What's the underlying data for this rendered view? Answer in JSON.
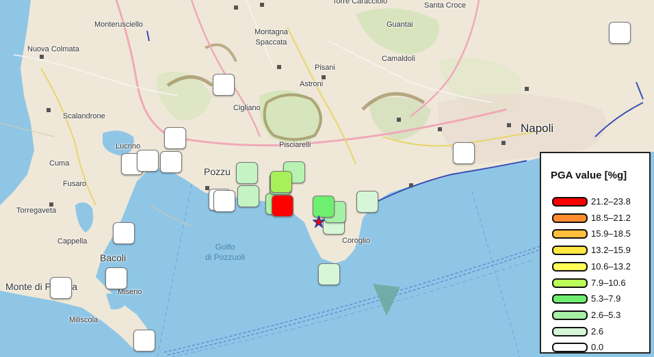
{
  "map": {
    "places": {
      "monterusciello": "Monterusciello",
      "nuova_colmata": "Nuova Colmata",
      "montagna_spaccata": "Montagna\nSpaccata",
      "pisani": "Pisani",
      "camaldoli": "Camaldoli",
      "guantai": "Guantai",
      "torre_caracciolo": "Torre Caracciolo",
      "santa_croce": "Santa Croce",
      "astroni": "Astroni",
      "scalandrone": "Scalandrone",
      "cigliano": "Cigliano",
      "napoli": "Napoli",
      "pisciarelli": "Pisciarelli",
      "lucrino": "Lucrino",
      "cuma": "Cuma",
      "fusaro": "Fusaro",
      "pozzuoli": "Pozzu",
      "torregaveta": "Torregaveta",
      "cappella": "Cappella",
      "bacoli": "Bacoli",
      "coroglio": "Coroglio",
      "golfo": "Golfo\ndi Pozzuoli",
      "monte_di_procida": "Monte di Procida",
      "miseno": "Miseno",
      "miliscola": "Miliscola"
    }
  },
  "legend": {
    "title": "PGA value [%g]",
    "items": [
      {
        "label": "21.2–23.8",
        "color": "#ff0000"
      },
      {
        "label": "18.5–21.2",
        "color": "#ff8c2e"
      },
      {
        "label": "15.9–18.5",
        "color": "#ffbe3c"
      },
      {
        "label": "13.2–15.9",
        "color": "#ffe640"
      },
      {
        "label": "10.6–13.2",
        "color": "#ffff55"
      },
      {
        "label": "7.9–10.6",
        "color": "#bdff5a"
      },
      {
        "label": "5.3–7.9",
        "color": "#6fef6f"
      },
      {
        "label": "2.6–5.3",
        "color": "#a6f0a6"
      },
      {
        "label": "2.6",
        "color": "#d7f6d7"
      },
      {
        "label": "0.0",
        "color": "#ffffff"
      }
    ]
  },
  "stations": [
    {
      "pga_class": "0.0",
      "color": "#ffffff"
    },
    {
      "pga_class": "0.0",
      "color": "#ffffff"
    },
    {
      "pga_class": "0.0",
      "color": "#ffffff"
    },
    {
      "pga_class": "0.0",
      "color": "#ffffff"
    },
    {
      "pga_class": "0.0",
      "color": "#ffffff"
    },
    {
      "pga_class": "0.0",
      "color": "#ffffff"
    },
    {
      "pga_class": "0.0",
      "color": "#ffffff"
    },
    {
      "pga_class": "0.0",
      "color": "#ffffff"
    },
    {
      "pga_class": "0.0",
      "color": "#ffffff"
    },
    {
      "pga_class": "0.0",
      "color": "#ffffff"
    },
    {
      "pga_class": "0.0",
      "color": "#ffffff"
    },
    {
      "pga_class": "0.0",
      "color": "#ffffff"
    },
    {
      "pga_class": "0.0",
      "color": "#ffffff"
    },
    {
      "pga_class": "2.6",
      "color": "#d7f6d7"
    },
    {
      "pga_class": "2.6",
      "color": "#d7f6d7"
    },
    {
      "pga_class": "2.6",
      "color": "#d7f6d7"
    },
    {
      "pga_class": "2.6–5.3",
      "color": "#c4f3c4"
    },
    {
      "pga_class": "2.6–5.3",
      "color": "#c4f3c4"
    },
    {
      "pga_class": "2.6–5.3",
      "color": "#b8f2b0"
    },
    {
      "pga_class": "2.6–5.3",
      "color": "#b0f0a0"
    },
    {
      "pga_class": "2.6–5.3",
      "color": "#a6f0a6"
    },
    {
      "pga_class": "2.6–5.3",
      "color": "#a6f0a6"
    },
    {
      "pga_class": "5.3–7.9",
      "color": "#6fef6f"
    },
    {
      "pga_class": "7.9–10.6",
      "color": "#a8f05a"
    },
    {
      "pga_class": "21.2–23.8",
      "color": "#ff0000"
    }
  ]
}
